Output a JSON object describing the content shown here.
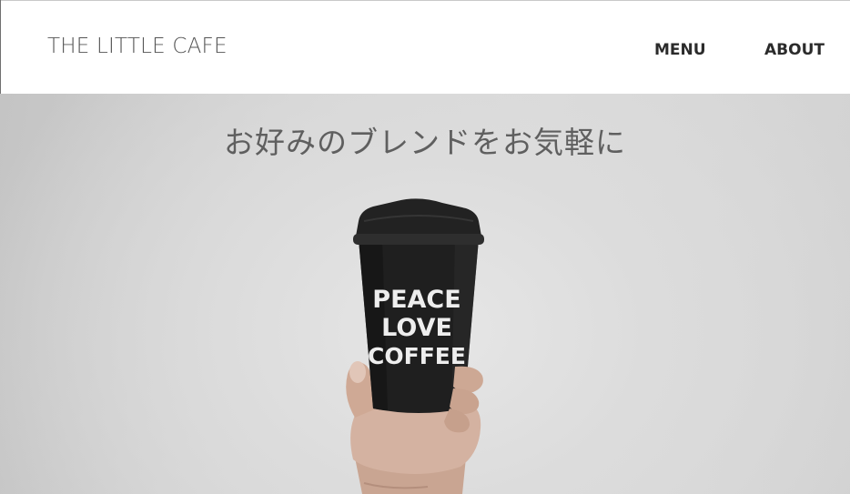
{
  "header": {
    "site_title": "THE LITTLE CAFE",
    "nav": [
      {
        "label": "MENU"
      },
      {
        "label": "ABOUT"
      }
    ]
  },
  "hero": {
    "heading": "お好みのブレンドをお気軽に",
    "cup_text": [
      "PEACE",
      "LOVE",
      "COFFEE"
    ]
  },
  "colors": {
    "header_background": "#ffffff",
    "title_text": "#555555",
    "nav_text": "#2b2b2b",
    "hero_background": "#d6d6d6",
    "hero_heading": "#5f5f5f",
    "cup": "#1c1c1c"
  }
}
